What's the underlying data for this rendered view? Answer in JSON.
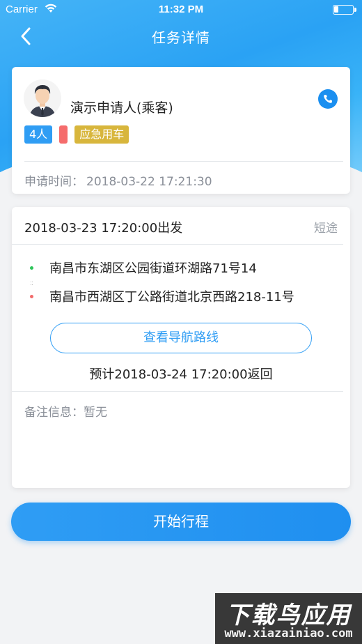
{
  "status_bar": {
    "carrier": "Carrier",
    "time": "11:32 PM"
  },
  "nav": {
    "title": "任务详情",
    "back_icon": "chevron-left-icon"
  },
  "applicant": {
    "name": "演示申请人(乘客)",
    "avatar_icon": "user-avatar",
    "phone_icon": "phone-icon",
    "tags": {
      "count": "4人",
      "urgent": "应急用车"
    },
    "apply_time_label": "申请时间：",
    "apply_time": "2018-03-22 17:21:30"
  },
  "trip": {
    "depart_time": "2018-03-23 17:20:00出发",
    "trip_type": "短途",
    "start_address": "南昌市东湖区公园街道环湖路71号14",
    "end_address": "南昌市西湖区丁公路街道北京西路218-11号",
    "nav_route_label": "查看导航路线",
    "return_time": "预计2018-03-24 17:20:00返回",
    "remark_label": "备注信息：",
    "remark_value": "暂无"
  },
  "actions": {
    "start_label": "开始行程"
  },
  "watermark": {
    "title": "下载鸟应用",
    "url": "www.xiazainiao.com"
  },
  "colors": {
    "primary": "#2f9df4",
    "urgent_tag": "#d8b63c",
    "red_tag": "#f56c6c",
    "start_dot": "#2ec45a",
    "end_dot": "#f26b6b"
  }
}
